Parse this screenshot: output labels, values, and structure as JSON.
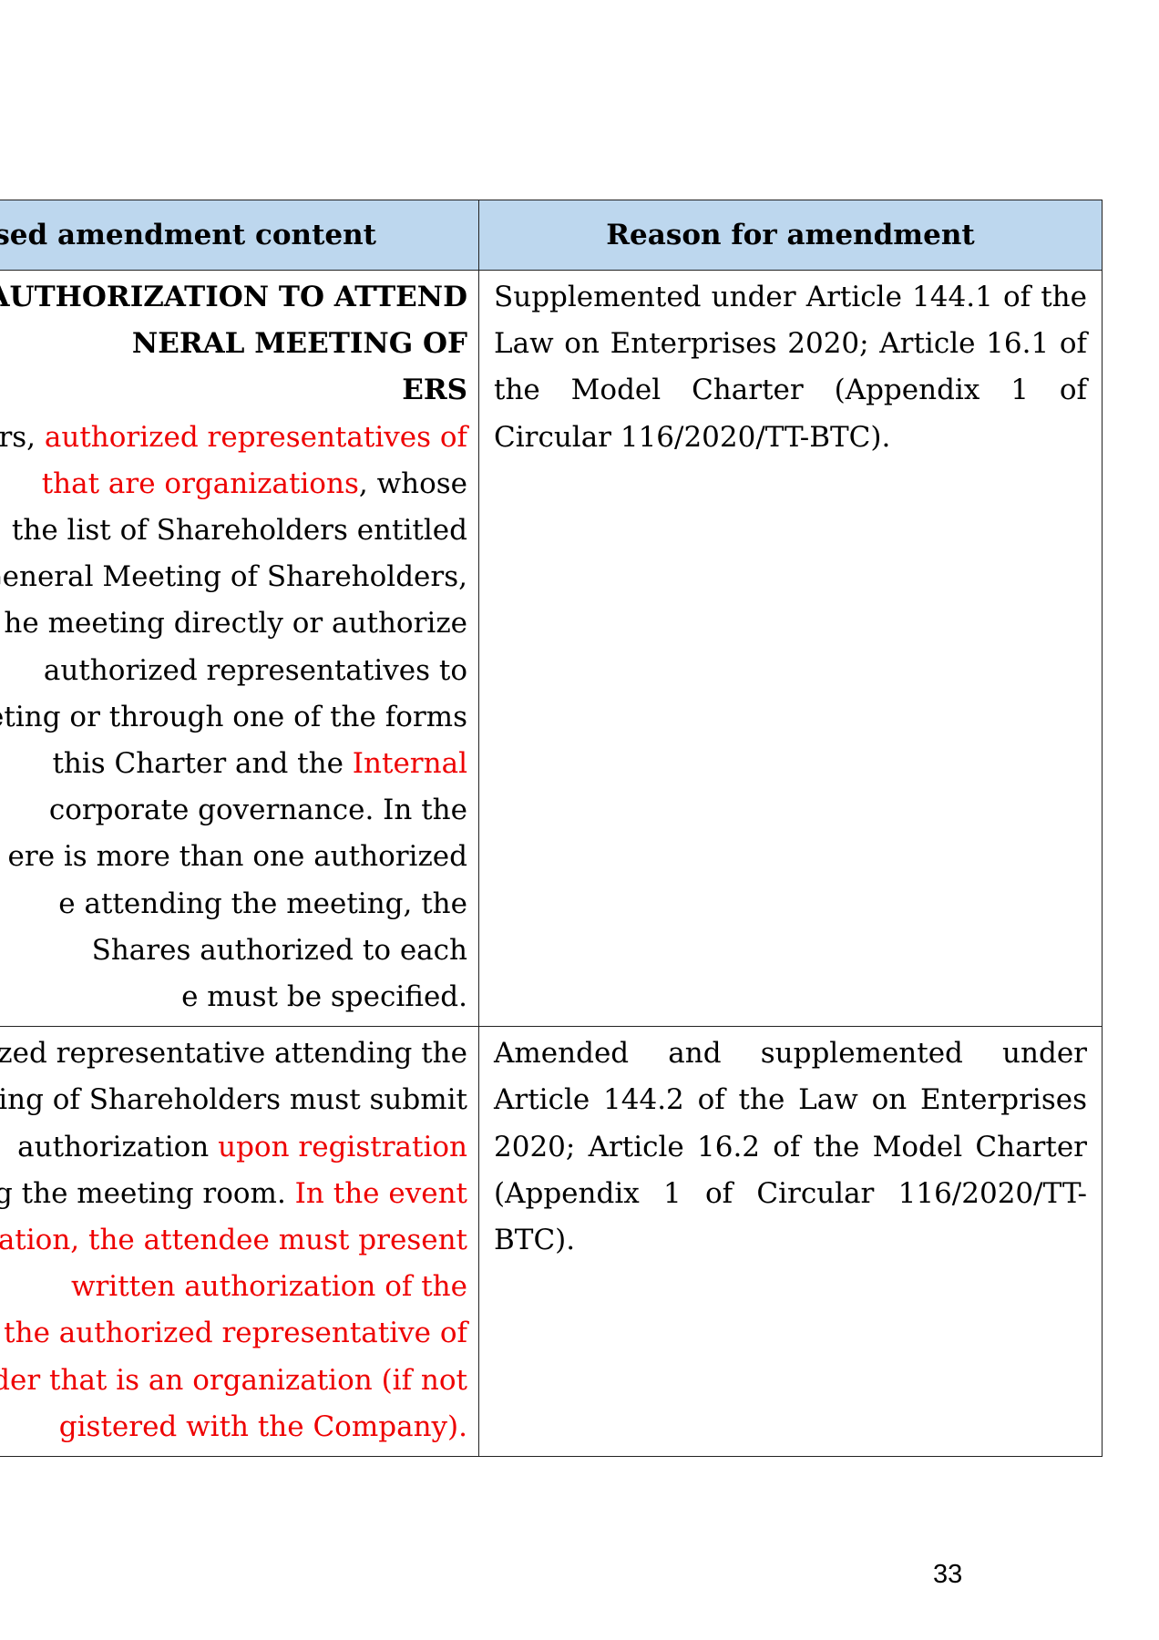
{
  "table": {
    "headers": [
      "sed amendment content",
      "Reason for amendment"
    ],
    "rows": [
      {
        "left_lines": [
          [
            {
              "t": "AUTHORIZATION TO ATTEND",
              "c": "hd"
            }
          ],
          [
            {
              "t": "NERAL MEETING OF",
              "c": "hd"
            }
          ],
          [
            {
              "t": "ERS",
              "c": "hd"
            }
          ],
          [
            {
              "t": "rs, ",
              "c": ""
            },
            {
              "t": "authorized representatives of",
              "c": "red"
            }
          ],
          [
            {
              "t": "that are organizations",
              "c": "red"
            },
            {
              "t": ", whose",
              "c": ""
            }
          ],
          [
            {
              "t": "the list of Shareholders entitled",
              "c": ""
            }
          ],
          [
            {
              "t": "General Meeting of Shareholders,",
              "c": ""
            }
          ],
          [
            {
              "t": "he meeting directly or authorize",
              "c": ""
            }
          ],
          [
            {
              "t": "authorized representatives to",
              "c": ""
            }
          ],
          [
            {
              "t": "eting or through one of the forms",
              "c": ""
            }
          ],
          [
            {
              "t": "this Charter and the ",
              "c": ""
            },
            {
              "t": "Internal",
              "c": "red"
            }
          ],
          [
            {
              "t": "corporate governance. In the",
              "c": ""
            }
          ],
          [
            {
              "t": "ere is more than one authorized",
              "c": ""
            }
          ],
          [
            {
              "t": "e attending the meeting, the",
              "c": ""
            }
          ],
          [
            {
              "t": "Shares authorized to each",
              "c": ""
            }
          ],
          [
            {
              "t": "e must be specified.",
              "c": ""
            }
          ]
        ],
        "reason": "Supplemented under Article 144.1 of the Law on Enterprises 2020; Article 16.1 of the Model Charter (Appendix 1 of Circular 116/2020/TT-BTC)."
      },
      {
        "left_lines": [
          [
            {
              "t": "ized representative attending the",
              "c": ""
            }
          ],
          [
            {
              "t": "ing of Shareholders must submit",
              "c": ""
            }
          ],
          [
            {
              "t": "authorization ",
              "c": ""
            },
            {
              "t": "upon registration",
              "c": "red"
            }
          ],
          [
            {
              "t": "ng the meeting room. ",
              "c": ""
            },
            {
              "t": "In the event",
              "c": "red"
            }
          ],
          [
            {
              "t": "zation, the attendee must present",
              "c": "red"
            }
          ],
          [
            {
              "t": "written authorization of the",
              "c": "red"
            }
          ],
          [
            {
              "t": "the authorized representative of",
              "c": "red"
            }
          ],
          [
            {
              "t": "der that is an organization (if not",
              "c": "red"
            }
          ],
          [
            {
              "t": "gistered with the Company).",
              "c": "red"
            }
          ]
        ],
        "reason": "Amended and supplemented under Article 144.2 of the Law on Enterprises 2020; Article 16.2 of the Model Charter (Appendix 1 of Circular 116/2020/TT-BTC)."
      }
    ]
  },
  "page_number": "33",
  "colors": {
    "header_bg": "#bdd7ee",
    "highlight": "#ee0000",
    "border": "#222222"
  }
}
